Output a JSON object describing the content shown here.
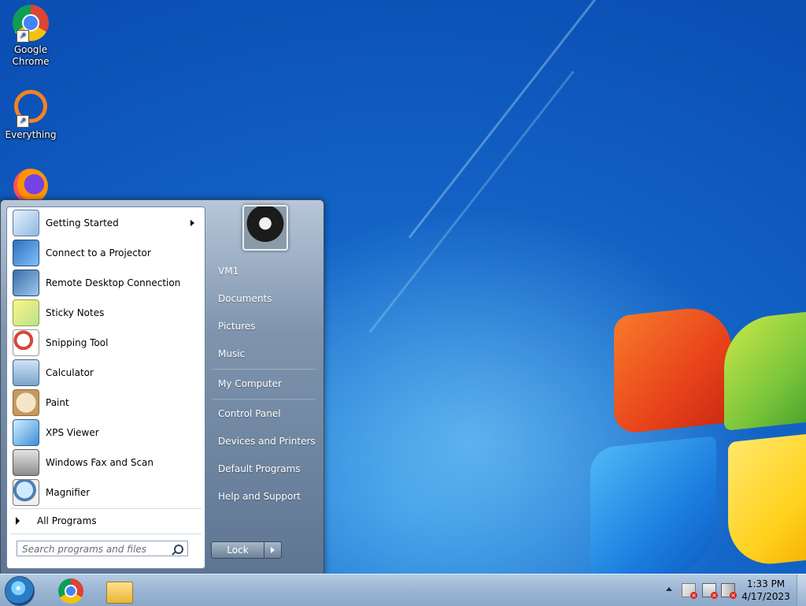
{
  "desktop": {
    "icons": [
      {
        "label": "Google Chrome"
      },
      {
        "label": "Everything"
      },
      {
        "label": ""
      }
    ]
  },
  "start_menu": {
    "programs": [
      {
        "label": "Getting Started",
        "icon": "getting-started-icon",
        "has_submenu": true
      },
      {
        "label": "Connect to a Projector",
        "icon": "projector-icon"
      },
      {
        "label": "Remote Desktop Connection",
        "icon": "remote-desktop-icon"
      },
      {
        "label": "Sticky Notes",
        "icon": "sticky-notes-icon"
      },
      {
        "label": "Snipping Tool",
        "icon": "snipping-tool-icon"
      },
      {
        "label": "Calculator",
        "icon": "calculator-icon"
      },
      {
        "label": "Paint",
        "icon": "paint-icon"
      },
      {
        "label": "XPS Viewer",
        "icon": "xps-viewer-icon"
      },
      {
        "label": "Windows Fax and Scan",
        "icon": "fax-scan-icon"
      },
      {
        "label": "Magnifier",
        "icon": "magnifier-icon"
      }
    ],
    "all_programs_label": "All Programs",
    "search_placeholder": "Search programs and files",
    "right_items": [
      "VM1",
      "Documents",
      "Pictures",
      "Music",
      "My Computer",
      "Control Panel",
      "Devices and Printers",
      "Default Programs",
      "Help and Support"
    ],
    "lock_label": "Lock"
  },
  "taskbar": {
    "pinned": [
      {
        "name": "Google Chrome",
        "icon": "chrome-icon"
      },
      {
        "name": "Windows Explorer",
        "icon": "folder-icon"
      }
    ],
    "clock": {
      "time": "1:33 PM",
      "date": "4/17/2023"
    }
  }
}
